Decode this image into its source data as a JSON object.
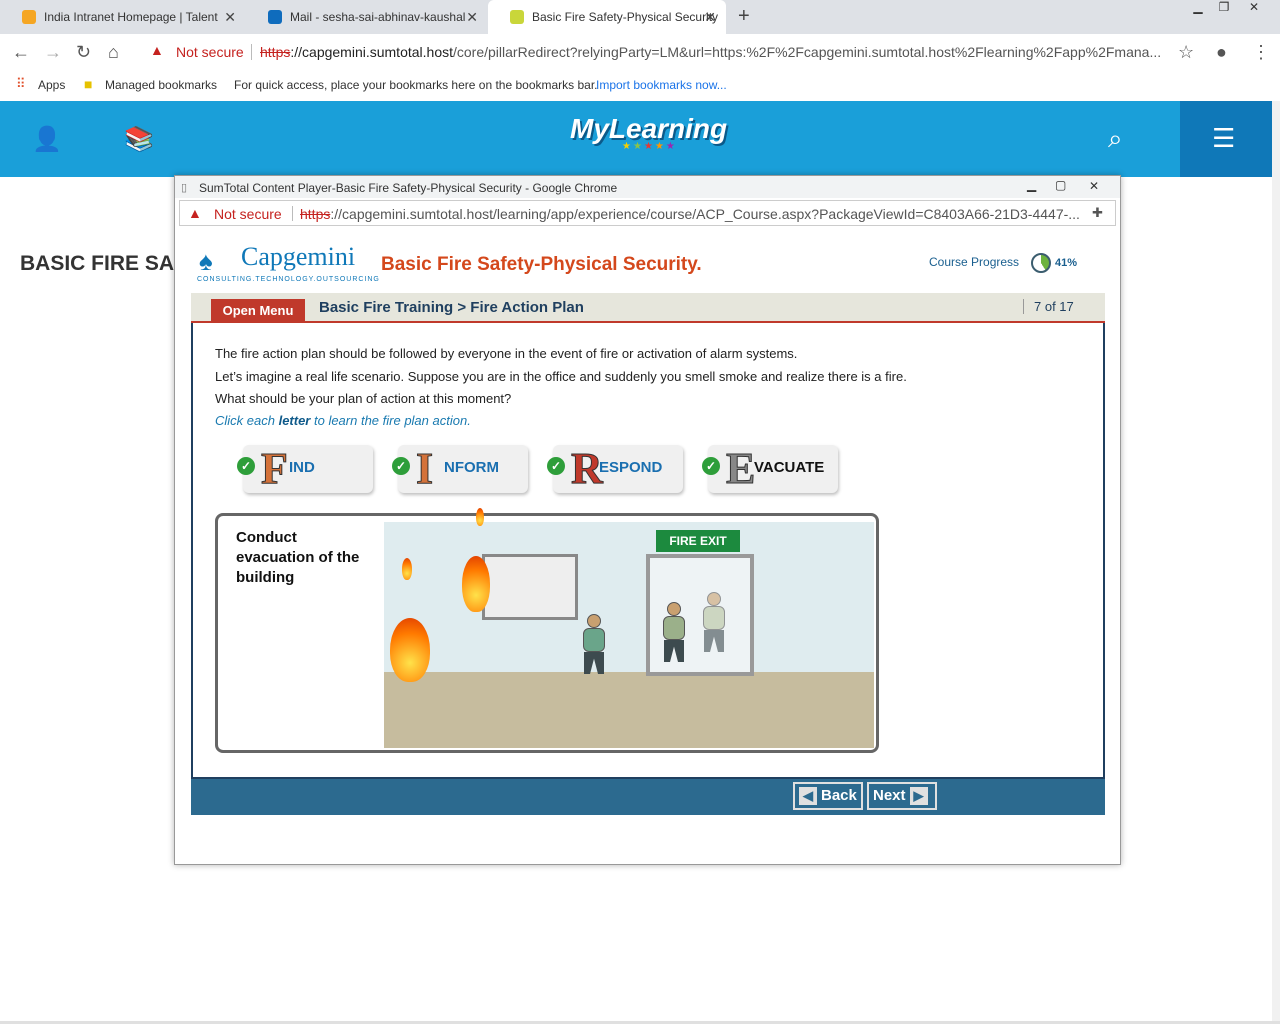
{
  "browser": {
    "tabs": [
      {
        "title": "India Intranet Homepage | Talent"
      },
      {
        "title": "Mail - sesha-sai-abhinav-kaushal"
      },
      {
        "title": "Basic Fire Safety-Physical Security"
      }
    ],
    "new_tab": "+",
    "security": "Not secure",
    "url_scheme": "https",
    "url_host": "://capgemini.sumtotal.host",
    "url_path": "/core/pillarRedirect?relyingParty=LM&url=https:%2F%2Fcapgemini.sumtotal.host%2Flearning%2Fapp%2Fmana...",
    "bookmarks": {
      "apps": "Apps",
      "managed": "Managed bookmarks",
      "hint": "For quick access, place your bookmarks here on the bookmarks bar.",
      "import": "Import bookmarks now..."
    }
  },
  "header": {
    "logo": "MyLearning",
    "brand_color": "#1a9fd9"
  },
  "page": {
    "title": "BASIC FIRE SAI"
  },
  "popup": {
    "title": "SumTotal Content Player-Basic Fire Safety-Physical Security - Google Chrome",
    "security": "Not secure",
    "url_scheme": "https",
    "url_rest": "://capgemini.sumtotal.host/learning/app/experience/course/ACP_Course.aspx?PackageViewId=C8403A66-21D3-4447-...",
    "course": {
      "logo": "Capgemini",
      "logo_tagline": "CONSULTING.TECHNOLOGY.OUTSOURCING",
      "title": "Basic Fire Safety-Physical Security.",
      "progress_label": "Course Progress",
      "progress_text": "41%",
      "progress_value": 0.41,
      "open_menu": "Open Menu",
      "breadcrumb": "Basic Fire Training > Fire Action Plan",
      "pager": "7 of 17",
      "intro_line1": "The fire action plan should be followed by everyone in the event of fire or activation of alarm systems.",
      "intro_line2": "Let’s imagine a real life scenario. Suppose you are in the office and suddenly you smell smoke and realize there is a fire.",
      "intro_line3": "What should be your plan of action at this moment?",
      "hint_pre": "Click each ",
      "hint_bold": "letter",
      "hint_post": " to learn the fire plan action.",
      "letters": [
        {
          "letter": "F",
          "rest": "IND",
          "color": "#d4723a"
        },
        {
          "letter": "I",
          "rest": "NFORM",
          "color": "#d4723a"
        },
        {
          "letter": "R",
          "rest": "ESPOND",
          "color": "#c0392b"
        },
        {
          "letter": "E",
          "rest": "VACUATE",
          "color": "#888888"
        }
      ],
      "scene_text": "Conduct evacuation of the building",
      "fire_exit": "FIRE EXIT",
      "back": "Back",
      "next": "Next"
    }
  }
}
